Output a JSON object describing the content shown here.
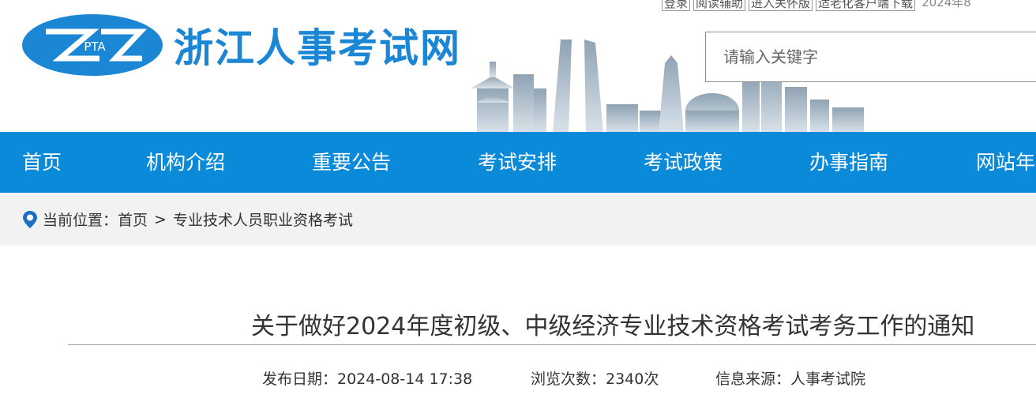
{
  "top_links": {
    "login": "登录",
    "reading_aid": "阅读辅助",
    "elder_mode": "进入关怀版",
    "client_download": "适老化客户端下载",
    "date": "2024年8"
  },
  "site": {
    "logo_mark": "PTA",
    "name": "浙江人事考试网"
  },
  "search": {
    "placeholder": "请输入关键字"
  },
  "nav": {
    "items": [
      "首页",
      "机构介绍",
      "重要公告",
      "考试安排",
      "考试政策",
      "办事指南",
      "网站年"
    ]
  },
  "breadcrumb": {
    "label": "当前位置：",
    "home": "首页",
    "separator": ">",
    "current": "专业技术人员职业资格考试"
  },
  "article": {
    "title": "关于做好2024年度初级、中级经济专业技术资格考试考务工作的通知",
    "publish_date": "发布日期：2024-08-14 17:38",
    "views": "浏览次数：2340次",
    "source": "信息来源：人事考试院"
  },
  "colors": {
    "brand_blue": "#1a86d4",
    "nav_blue": "#0a8ad8",
    "breadcrumb_bg": "#f2f2f2"
  },
  "icons": {
    "location": "location-pin-icon"
  }
}
